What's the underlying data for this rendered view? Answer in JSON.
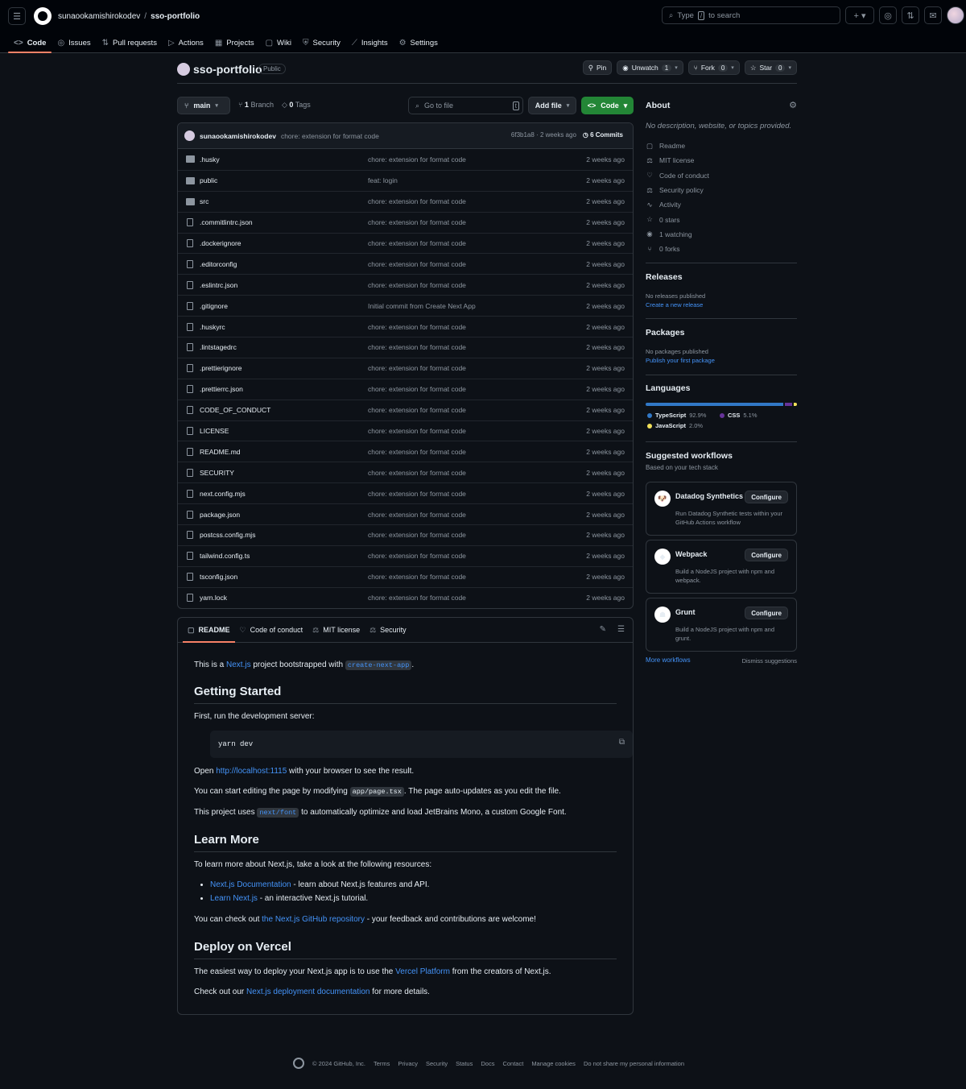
{
  "header": {
    "owner": "sunaookamishirokodev",
    "repo": "sso-portfolio",
    "search_prefix": "Type",
    "search_key": "/",
    "search_suffix": "to search"
  },
  "nav_tabs": [
    {
      "label": "Code",
      "icon": "code-icon"
    },
    {
      "label": "Issues",
      "icon": "issue-icon"
    },
    {
      "label": "Pull requests",
      "icon": "pull-request-icon"
    },
    {
      "label": "Actions",
      "icon": "play-icon"
    },
    {
      "label": "Projects",
      "icon": "table-icon"
    },
    {
      "label": "Wiki",
      "icon": "book-icon"
    },
    {
      "label": "Security",
      "icon": "shield-icon"
    },
    {
      "label": "Insights",
      "icon": "graph-icon"
    },
    {
      "label": "Settings",
      "icon": "gear-icon"
    }
  ],
  "repo_header": {
    "name": "sso-portfolio",
    "visibility": "Public",
    "pin": "Pin",
    "unwatch": "Unwatch",
    "watch_count": "1",
    "fork": "Fork",
    "fork_count": "0",
    "star": "Star",
    "star_count": "0"
  },
  "toolbar": {
    "branch": "main",
    "branch_count": "1",
    "branch_label": "Branch",
    "tag_count": "0",
    "tag_label": "Tags",
    "goto_placeholder": "Go to file",
    "goto_key": "t",
    "add_file": "Add file",
    "code": "Code"
  },
  "latest_commit": {
    "author": "sunaookamishirokodev",
    "message": "chore: extension for format code",
    "hash": "6f3b1a8",
    "sep": "·",
    "age": "2 weeks ago",
    "commits": "6 Commits"
  },
  "files": [
    {
      "name": ".husky",
      "type": "dir",
      "message": "chore: extension for format code",
      "date": "2 weeks ago"
    },
    {
      "name": "public",
      "type": "dir",
      "message": "feat: login",
      "date": "2 weeks ago"
    },
    {
      "name": "src",
      "type": "dir",
      "message": "chore: extension for format code",
      "date": "2 weeks ago"
    },
    {
      "name": ".commitlintrc.json",
      "type": "file",
      "message": "chore: extension for format code",
      "date": "2 weeks ago"
    },
    {
      "name": ".dockerignore",
      "type": "file",
      "message": "chore: extension for format code",
      "date": "2 weeks ago"
    },
    {
      "name": ".editorconfig",
      "type": "file",
      "message": "chore: extension for format code",
      "date": "2 weeks ago"
    },
    {
      "name": ".eslintrc.json",
      "type": "file",
      "message": "chore: extension for format code",
      "date": "2 weeks ago"
    },
    {
      "name": ".gitignore",
      "type": "file",
      "message": "Initial commit from Create Next App",
      "date": "2 weeks ago"
    },
    {
      "name": ".huskyrc",
      "type": "file",
      "message": "chore: extension for format code",
      "date": "2 weeks ago"
    },
    {
      "name": ".lintstagedrc",
      "type": "file",
      "message": "chore: extension for format code",
      "date": "2 weeks ago"
    },
    {
      "name": ".prettierignore",
      "type": "file",
      "message": "chore: extension for format code",
      "date": "2 weeks ago"
    },
    {
      "name": ".prettierrc.json",
      "type": "file",
      "message": "chore: extension for format code",
      "date": "2 weeks ago"
    },
    {
      "name": "CODE_OF_CONDUCT",
      "type": "file",
      "message": "chore: extension for format code",
      "date": "2 weeks ago"
    },
    {
      "name": "LICENSE",
      "type": "file",
      "message": "chore: extension for format code",
      "date": "2 weeks ago"
    },
    {
      "name": "README.md",
      "type": "file",
      "message": "chore: extension for format code",
      "date": "2 weeks ago"
    },
    {
      "name": "SECURITY",
      "type": "file",
      "message": "chore: extension for format code",
      "date": "2 weeks ago"
    },
    {
      "name": "next.config.mjs",
      "type": "file",
      "message": "chore: extension for format code",
      "date": "2 weeks ago"
    },
    {
      "name": "package.json",
      "type": "file",
      "message": "chore: extension for format code",
      "date": "2 weeks ago"
    },
    {
      "name": "postcss.config.mjs",
      "type": "file",
      "message": "chore: extension for format code",
      "date": "2 weeks ago"
    },
    {
      "name": "tailwind.config.ts",
      "type": "file",
      "message": "chore: extension for format code",
      "date": "2 weeks ago"
    },
    {
      "name": "tsconfig.json",
      "type": "file",
      "message": "chore: extension for format code",
      "date": "2 weeks ago"
    },
    {
      "name": "yarn.lock",
      "type": "file",
      "message": "chore: extension for format code",
      "date": "2 weeks ago"
    }
  ],
  "readme_tabs": [
    {
      "label": "README",
      "icon": "book-icon"
    },
    {
      "label": "Code of conduct",
      "icon": "heart-icon"
    },
    {
      "label": "MIT license",
      "icon": "law-icon"
    },
    {
      "label": "Security",
      "icon": "law-icon"
    }
  ],
  "readme": {
    "intro_pre": "This is a ",
    "intro_link": "Next.js",
    "intro_mid": " project bootstrapped with ",
    "intro_code": "create-next-app",
    "intro_post": ".",
    "h_getting_started": "Getting Started",
    "run_server": "First, run the development server:",
    "code_cmd": "yarn dev",
    "open_pre": "Open ",
    "open_link": "http://localhost:1115",
    "open_post": " with your browser to see the result.",
    "edit_pre": "You can start editing the page by modifying ",
    "edit_code": "app/page.tsx",
    "edit_post": ". The page auto-updates as you edit the file.",
    "font_pre": "This project uses ",
    "font_code": "next/font",
    "font_post": " to automatically optimize and load JetBrains Mono, a custom Google Font.",
    "h_learn_more": "Learn More",
    "learn_intro": "To learn more about Next.js, take a look at the following resources:",
    "li1_link": "Next.js Documentation",
    "li1_text": " - learn about Next.js features and API.",
    "li2_link": "Learn Next.js",
    "li2_text": " - an interactive Next.js tutorial.",
    "repo_pre": "You can check out ",
    "repo_link": "the Next.js GitHub repository",
    "repo_post": " - your feedback and contributions are welcome!",
    "h_deploy": "Deploy on Vercel",
    "deploy_pre": "The easiest way to deploy your Next.js app is to use the ",
    "deploy_link": "Vercel Platform",
    "deploy_post": " from the creators of Next.js.",
    "docs_pre": "Check out our ",
    "docs_link": "Next.js deployment documentation",
    "docs_post": " for more details."
  },
  "about": {
    "title": "About",
    "description": "No description, website, or topics provided.",
    "items": [
      {
        "label": "Readme",
        "icon": "book-icon"
      },
      {
        "label": "MIT license",
        "icon": "law-icon"
      },
      {
        "label": "Code of conduct",
        "icon": "heart-icon"
      },
      {
        "label": "Security policy",
        "icon": "law-icon"
      },
      {
        "label": "Activity",
        "icon": "pulse-icon"
      },
      {
        "label": "0 stars",
        "icon": "star-icon"
      },
      {
        "label": "1 watching",
        "icon": "eye-icon"
      },
      {
        "label": "0 forks",
        "icon": "fork-icon"
      }
    ]
  },
  "releases": {
    "title": "Releases",
    "none": "No releases published",
    "link": "Create a new release"
  },
  "packages": {
    "title": "Packages",
    "none": "No packages published",
    "link": "Publish your first package"
  },
  "languages": {
    "title": "Languages",
    "items": [
      {
        "name": "TypeScript",
        "percent": "92.9%",
        "value": 92.9,
        "color": "#3178c6"
      },
      {
        "name": "CSS",
        "percent": "5.1%",
        "value": 5.1,
        "color": "#663399"
      },
      {
        "name": "JavaScript",
        "percent": "2.0%",
        "value": 2.0,
        "color": "#f1e05a"
      }
    ]
  },
  "workflows": {
    "title": "Suggested workflows",
    "subtitle": "Based on your tech stack",
    "items": [
      {
        "name": "Datadog Synthetics",
        "desc": "Run Datadog Synthetic tests within your GitHub Actions workflow",
        "button": "Configure",
        "icon": "datadog-icon"
      },
      {
        "name": "Webpack",
        "desc": "Build a NodeJS project with npm and webpack.",
        "button": "Configure",
        "icon": "webpack-icon"
      },
      {
        "name": "Grunt",
        "desc": "Build a NodeJS project with npm and grunt.",
        "button": "Configure",
        "icon": "grunt-icon"
      }
    ],
    "more": "More workflows",
    "dismiss": "Dismiss suggestions"
  },
  "footer": {
    "copyright": "© 2024 GitHub, Inc.",
    "links": [
      "Terms",
      "Privacy",
      "Security",
      "Status",
      "Docs",
      "Contact",
      "Manage cookies",
      "Do not share my personal information"
    ]
  }
}
